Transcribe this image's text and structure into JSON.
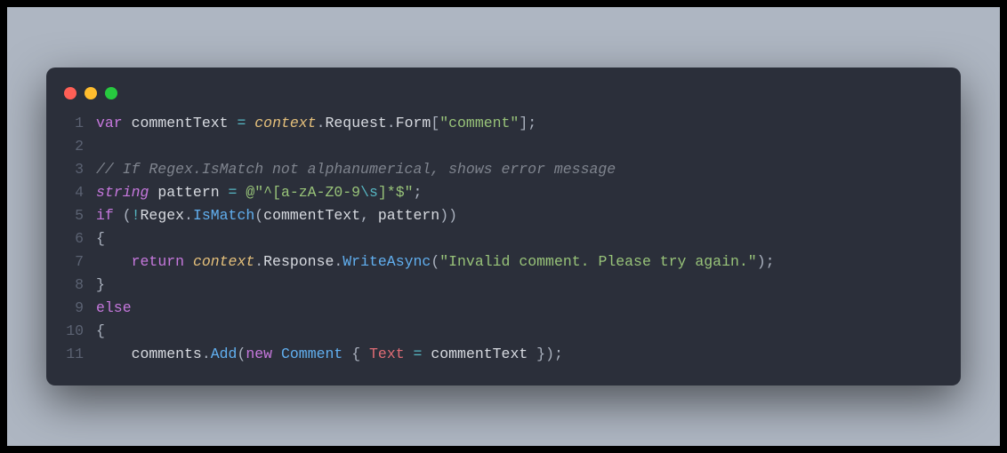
{
  "window": {
    "traffic_light_colors": {
      "red": "#ff5f56",
      "yellow": "#ffbd2e",
      "green": "#27c93f"
    }
  },
  "code": {
    "lines": [
      {
        "num": "1",
        "tokens": [
          {
            "cls": "tok-kw",
            "t": "var"
          },
          {
            "cls": "tok-default",
            "t": " commentText "
          },
          {
            "cls": "tok-op",
            "t": "="
          },
          {
            "cls": "tok-default",
            "t": " "
          },
          {
            "cls": "tok-var-it",
            "t": "context"
          },
          {
            "cls": "tok-punct",
            "t": "."
          },
          {
            "cls": "tok-default",
            "t": "Request"
          },
          {
            "cls": "tok-punct",
            "t": "."
          },
          {
            "cls": "tok-default",
            "t": "Form"
          },
          {
            "cls": "tok-punct",
            "t": "["
          },
          {
            "cls": "tok-str",
            "t": "\"comment\""
          },
          {
            "cls": "tok-punct",
            "t": "];"
          }
        ]
      },
      {
        "num": "2",
        "tokens": []
      },
      {
        "num": "3",
        "tokens": [
          {
            "cls": "tok-comment",
            "t": "// If Regex.IsMatch not alphanumerical, shows error message"
          }
        ]
      },
      {
        "num": "4",
        "tokens": [
          {
            "cls": "tok-kw-it",
            "t": "string"
          },
          {
            "cls": "tok-default",
            "t": " pattern "
          },
          {
            "cls": "tok-op",
            "t": "="
          },
          {
            "cls": "tok-default",
            "t": " "
          },
          {
            "cls": "tok-str",
            "t": "@\"^[a-zA-Z0-9"
          },
          {
            "cls": "tok-esc",
            "t": "\\s"
          },
          {
            "cls": "tok-str",
            "t": "]*$\""
          },
          {
            "cls": "tok-punct",
            "t": ";"
          }
        ]
      },
      {
        "num": "5",
        "tokens": [
          {
            "cls": "tok-kw",
            "t": "if"
          },
          {
            "cls": "tok-default",
            "t": " "
          },
          {
            "cls": "tok-punct",
            "t": "("
          },
          {
            "cls": "tok-op",
            "t": "!"
          },
          {
            "cls": "tok-default",
            "t": "Regex"
          },
          {
            "cls": "tok-punct",
            "t": "."
          },
          {
            "cls": "tok-func",
            "t": "IsMatch"
          },
          {
            "cls": "tok-punct",
            "t": "("
          },
          {
            "cls": "tok-default",
            "t": "commentText"
          },
          {
            "cls": "tok-punct",
            "t": ","
          },
          {
            "cls": "tok-default",
            "t": " pattern"
          },
          {
            "cls": "tok-punct",
            "t": "))"
          }
        ]
      },
      {
        "num": "6",
        "tokens": [
          {
            "cls": "tok-punct",
            "t": "{"
          }
        ]
      },
      {
        "num": "7",
        "tokens": [
          {
            "cls": "tok-default",
            "t": "    "
          },
          {
            "cls": "tok-kw",
            "t": "return"
          },
          {
            "cls": "tok-default",
            "t": " "
          },
          {
            "cls": "tok-var-it",
            "t": "context"
          },
          {
            "cls": "tok-punct",
            "t": "."
          },
          {
            "cls": "tok-default",
            "t": "Response"
          },
          {
            "cls": "tok-punct",
            "t": "."
          },
          {
            "cls": "tok-func",
            "t": "WriteAsync"
          },
          {
            "cls": "tok-punct",
            "t": "("
          },
          {
            "cls": "tok-str",
            "t": "\"Invalid comment. Please try again.\""
          },
          {
            "cls": "tok-punct",
            "t": ");"
          }
        ]
      },
      {
        "num": "8",
        "tokens": [
          {
            "cls": "tok-punct",
            "t": "}"
          }
        ]
      },
      {
        "num": "9",
        "tokens": [
          {
            "cls": "tok-kw",
            "t": "else"
          }
        ]
      },
      {
        "num": "10",
        "tokens": [
          {
            "cls": "tok-punct",
            "t": "{"
          }
        ]
      },
      {
        "num": "11",
        "tokens": [
          {
            "cls": "tok-default",
            "t": "    comments"
          },
          {
            "cls": "tok-punct",
            "t": "."
          },
          {
            "cls": "tok-func",
            "t": "Add"
          },
          {
            "cls": "tok-punct",
            "t": "("
          },
          {
            "cls": "tok-kw",
            "t": "new"
          },
          {
            "cls": "tok-default",
            "t": " "
          },
          {
            "cls": "tok-class",
            "t": "Comment"
          },
          {
            "cls": "tok-default",
            "t": " "
          },
          {
            "cls": "tok-punct",
            "t": "{"
          },
          {
            "cls": "tok-default",
            "t": " "
          },
          {
            "cls": "tok-prop",
            "t": "Text"
          },
          {
            "cls": "tok-default",
            "t": " "
          },
          {
            "cls": "tok-op",
            "t": "="
          },
          {
            "cls": "tok-default",
            "t": " commentText "
          },
          {
            "cls": "tok-punct",
            "t": "});"
          }
        ]
      }
    ]
  }
}
